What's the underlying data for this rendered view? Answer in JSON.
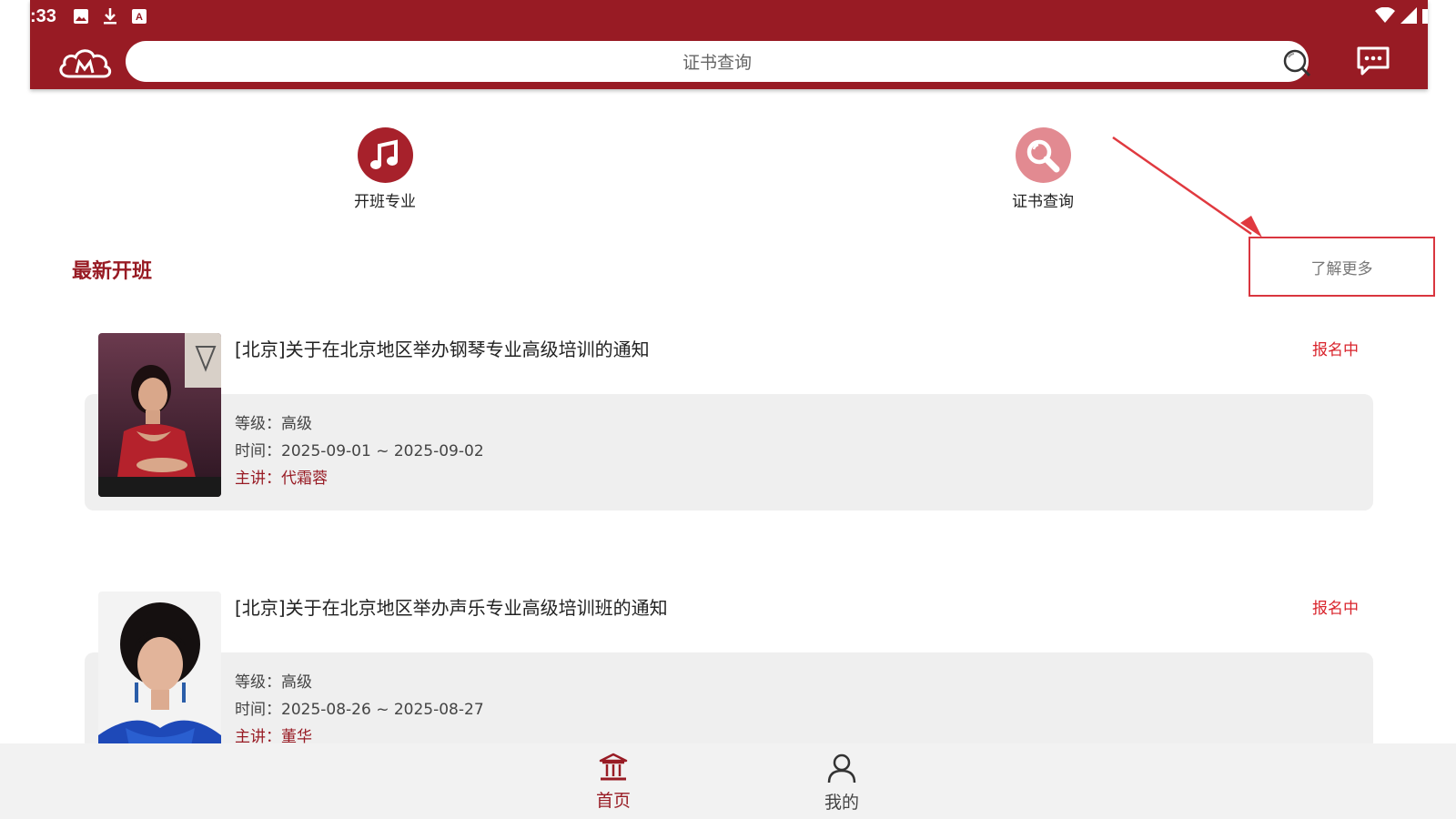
{
  "status_bar": {
    "time": ":33",
    "icons": [
      "image-icon",
      "download-icon",
      "keyboard-a-icon",
      "wifi-icon",
      "signal-icon",
      "battery-icon"
    ]
  },
  "header": {
    "search_placeholder": "证书查询",
    "colors": {
      "brand": "#981b24",
      "accent_red": "#d9232b"
    }
  },
  "quick_links": [
    {
      "label": "开班专业",
      "icon": "music-note-icon",
      "color": "#a7212b"
    },
    {
      "label": "证书查询",
      "icon": "magnifier-icon",
      "color": "#e28a91"
    }
  ],
  "section": {
    "title": "最新开班",
    "more_label": "了解更多"
  },
  "courses": [
    {
      "title": "[北京]关于在北京地区举办钢琴专业高级培训的通知",
      "status": "报名中",
      "level": "等级：高级",
      "dates": "时间：2025-09-01 ~ 2025-09-02",
      "teacher": "主讲：代霜蓉"
    },
    {
      "title": "[北京]关于在北京地区举办声乐专业高级培训班的通知",
      "status": "报名中",
      "level": "等级：高级",
      "dates": "时间：2025-08-26 ~ 2025-08-27",
      "teacher": "主讲：董华"
    }
  ],
  "bottom_nav": [
    {
      "label": "首页",
      "icon": "home-building-icon",
      "active": true
    },
    {
      "label": "我的",
      "icon": "user-icon",
      "active": false
    }
  ]
}
